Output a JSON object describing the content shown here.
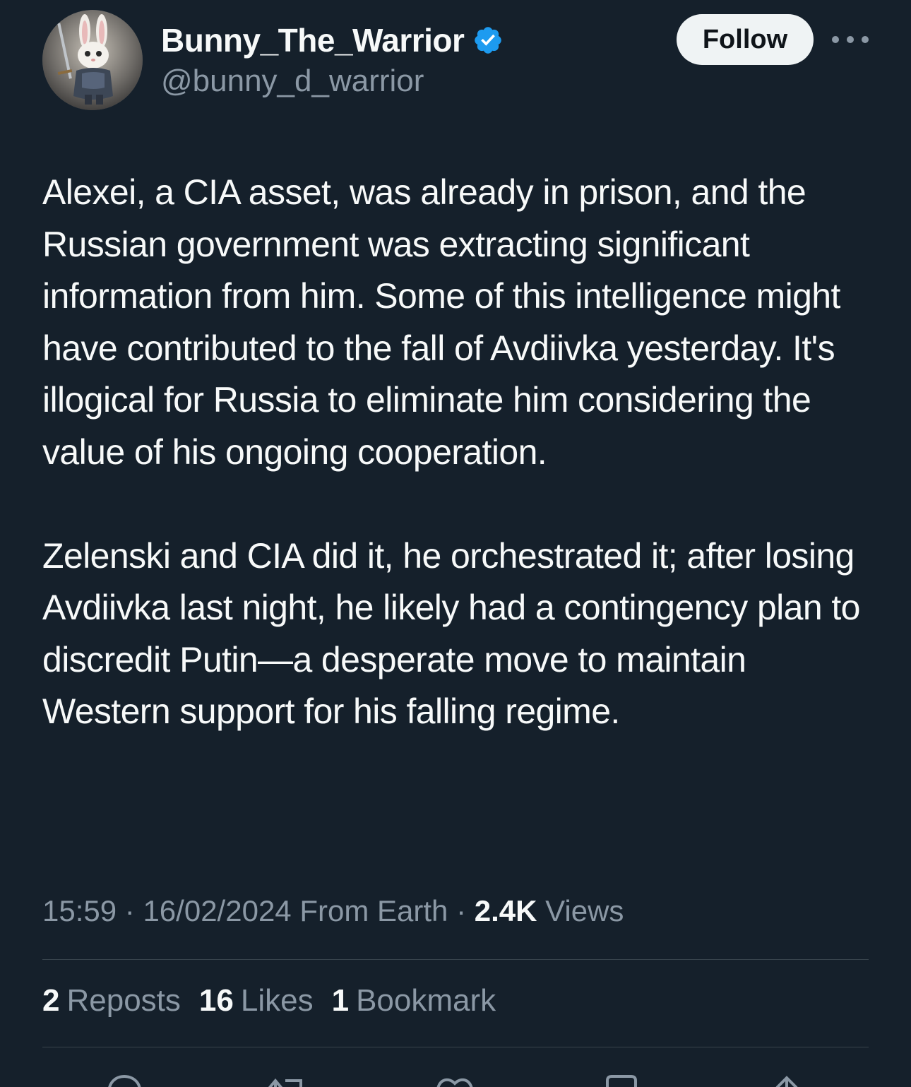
{
  "author": {
    "display_name": "Bunny_The_Warrior",
    "handle": "@bunny_d_warrior",
    "verified": true,
    "verified_color": "#1d9bf0"
  },
  "actions": {
    "follow_label": "Follow"
  },
  "tweet": {
    "paragraphs": [
      "Alexei, a CIA asset, was already in prison, and the Russian government was extracting significant information from him. Some of this intelligence might have contributed to the fall of Avdiivka yesterday. It's illogical for Russia to eliminate him considering the value of his ongoing cooperation.",
      "Zelenski and CIA did it, he orchestrated it; after losing Avdiivka last night, he likely had a contingency plan to discredit Putin—a desperate move to maintain Western support for his falling regime."
    ]
  },
  "meta": {
    "time": "15:59",
    "separator": "·",
    "date": "16/02/2024",
    "source": "From Earth",
    "views_count": "2.4K",
    "views_label": "Views"
  },
  "stats": {
    "reposts_count": "2",
    "reposts_label": "Reposts",
    "likes_count": "16",
    "likes_label": "Likes",
    "bookmarks_count": "1",
    "bookmarks_label": "Bookmark"
  },
  "action_icons": [
    "reply-icon",
    "repost-icon",
    "like-icon",
    "bookmark-icon",
    "share-icon"
  ],
  "colors": {
    "background": "#15202b",
    "text_primary": "#f7f9f9",
    "text_secondary": "#8b98a5",
    "divider": "#38444d",
    "follow_bg": "#eff3f4"
  }
}
